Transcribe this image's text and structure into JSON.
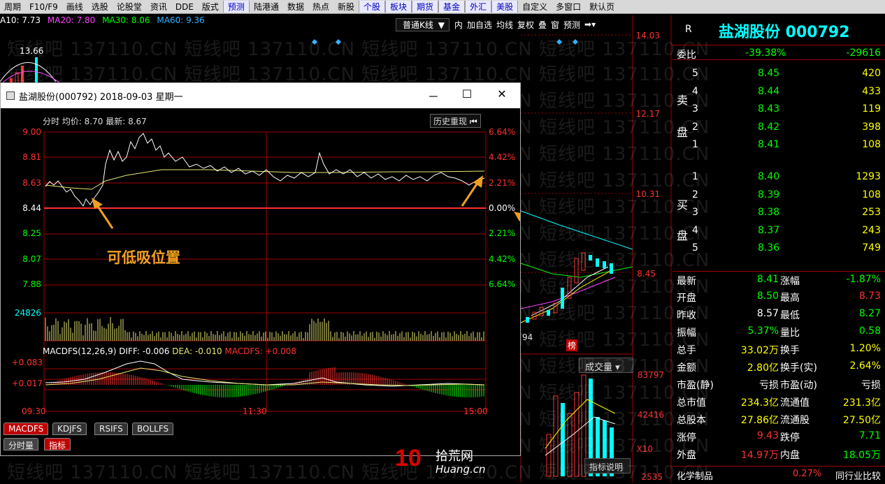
{
  "menu": [
    "周期",
    "F10/F9",
    "画线",
    "选股",
    "论股堂",
    "资讯",
    "DDE",
    "版式",
    "预测",
    "陆港通",
    "数据",
    "热点",
    "新股",
    "个股",
    "板块",
    "期货",
    "基金",
    "外汇",
    "美股",
    "自定义",
    "多窗口",
    "默认页"
  ],
  "ma_line": {
    "a10": "A10: 7.73",
    "ma20": "MA20: 7.80",
    "ma30": "MA30: 8.06",
    "ma60": "MA60: 9.36"
  },
  "kline_toolbar": {
    "dropdown": "普通K线",
    "items": [
      "内",
      "加自选",
      "均线",
      "复权",
      "叠",
      "窗",
      "预测"
    ]
  },
  "kline": {
    "high_label": "13.66",
    "price_labels": [
      "14.03",
      "12.17",
      "10.31",
      "8.45",
      "83797",
      "42416",
      "X10",
      "2535"
    ],
    "date_tail": "94",
    "bang": "榜",
    "volume_dropdown": "成交量",
    "indicator_btn": "指标说明"
  },
  "watermark": "短线吧 137110.CN 短线吧 137110.CN 短线吧 137110.CN 短线吧 137110.CN",
  "quote": {
    "r": "R",
    "name": "盐湖股份 000792",
    "weibi_label": "委比",
    "weibi_pct": "-39.38%",
    "weibi_val": "-29616",
    "sell_label": [
      "卖",
      "盘"
    ],
    "buy_label": [
      "买",
      "盘"
    ],
    "sell": [
      {
        "n": "5",
        "p": "8.45",
        "v": "420"
      },
      {
        "n": "4",
        "p": "8.44",
        "v": "433"
      },
      {
        "n": "3",
        "p": "8.43",
        "v": "119"
      },
      {
        "n": "2",
        "p": "8.42",
        "v": "398"
      },
      {
        "n": "1",
        "p": "8.41",
        "v": "108"
      }
    ],
    "buy": [
      {
        "n": "1",
        "p": "8.40",
        "v": "1293"
      },
      {
        "n": "2",
        "p": "8.39",
        "v": "108"
      },
      {
        "n": "3",
        "p": "8.38",
        "v": "253"
      },
      {
        "n": "4",
        "p": "8.37",
        "v": "243"
      },
      {
        "n": "5",
        "p": "8.36",
        "v": "749"
      }
    ],
    "stats": [
      {
        "l1": "最新",
        "v1": "8.41",
        "c1": "g",
        "l2": "涨幅",
        "v2": "-1.87%",
        "c2": "g"
      },
      {
        "l1": "开盘",
        "v1": "8.50",
        "c1": "g",
        "l2": "最高",
        "v2": "8.73",
        "c2": "r"
      },
      {
        "l1": "昨收",
        "v1": "8.57",
        "c1": "w",
        "l2": "最低",
        "v2": "8.27",
        "c2": "g"
      },
      {
        "l1": "振幅",
        "v1": "5.37%",
        "c1": "g",
        "l2": "量比",
        "v2": "0.58",
        "c2": "g"
      },
      {
        "l1": "总手",
        "v1": "33.02万",
        "c1": "y",
        "l2": "换手",
        "v2": "1.20%",
        "c2": "y"
      },
      {
        "l1": "金额",
        "v1": "2.80亿",
        "c1": "y",
        "l2": "换手(实)",
        "v2": "2.64%",
        "c2": "y"
      },
      {
        "l1": "市盈(静)",
        "v1": "亏损",
        "c1": "w",
        "l2": "市盈(动)",
        "v2": "亏损",
        "c2": "w"
      },
      {
        "l1": "总市值",
        "v1": "234.3亿",
        "c1": "y",
        "l2": "流通值",
        "v2": "231.3亿",
        "c2": "y"
      },
      {
        "l1": "总股本",
        "v1": "27.86亿",
        "c1": "y",
        "l2": "流通股",
        "v2": "27.50亿",
        "c2": "y"
      },
      {
        "l1": "涨停",
        "v1": "9.43",
        "c1": "r",
        "l2": "跌停",
        "v2": "7.71",
        "c2": "g"
      },
      {
        "l1": "外盘",
        "v1": "14.97万",
        "c1": "r",
        "l2": "内盘",
        "v2": "18.05万",
        "c2": "g"
      }
    ],
    "industry": "化学制品",
    "industry_pct": "0.27%",
    "industry_cmp": "同行业比较"
  },
  "popup": {
    "title": "盐湖股份(000792) 2018-09-03 星期一",
    "minimize": "－",
    "maximize": "☐",
    "close": "✕",
    "info_label": "分时 均价: 8.70 最新: 8.67",
    "history_btn": "历史重现",
    "left_axis": [
      "9.00",
      "8.81",
      "8.63",
      "8.44",
      "8.25",
      "8.07",
      "7.88"
    ],
    "right_axis": [
      "6.64%",
      "4.42%",
      "2.21%",
      "0.00%",
      "2.21%",
      "4.42%",
      "6.64%"
    ],
    "volume_max": "24826",
    "annotation": "可低吸位置",
    "macd_label": "MACDFS(12,26,9) DIFF: -0.006",
    "dea_label": "DEA: -0.010",
    "macdfs_label": "MACDFS: +0.008",
    "macd_axis": [
      "+0.083",
      "+0.017"
    ],
    "time_axis": [
      "09:30",
      "11:30",
      "15:00"
    ],
    "tabs": [
      "MACDFS",
      "KDJFS",
      "RSIFS",
      "BOLLFS"
    ],
    "bottom_tabs": [
      "分时量",
      "指标"
    ]
  },
  "logo": {
    "num": "10",
    "cn": "拾荒网",
    "en": "Huang.cn"
  },
  "colors": {
    "red": "#ff3030",
    "green": "#00ff00",
    "yellow": "#ffff00",
    "cyan": "#00ffff",
    "orange": "#f0a020"
  }
}
